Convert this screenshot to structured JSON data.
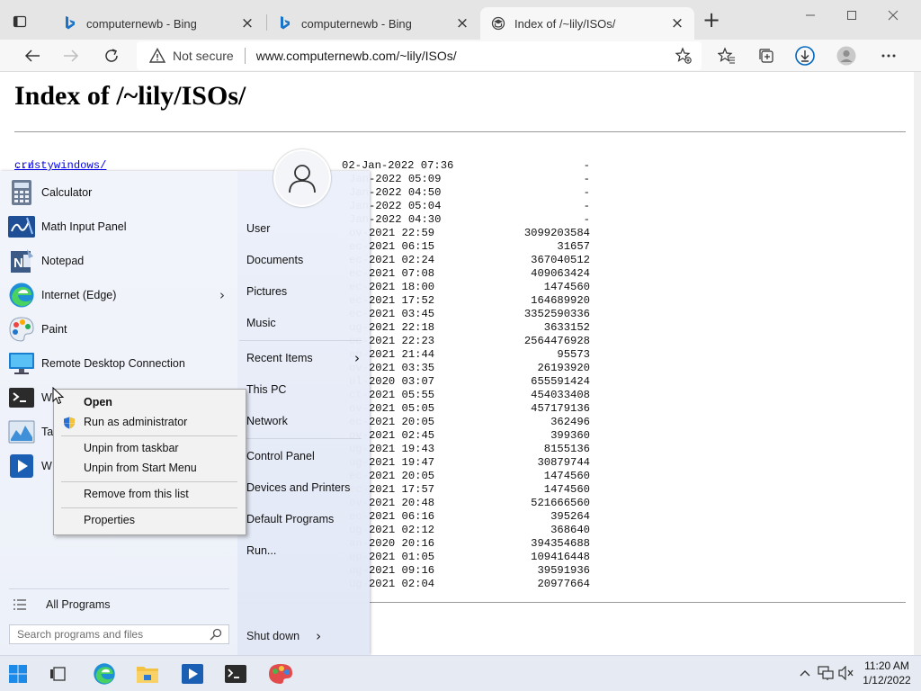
{
  "browser": {
    "tabs": [
      {
        "label": "computernewb - Bing",
        "favicon": "bing-icon",
        "active": false
      },
      {
        "label": "computernewb - Bing",
        "favicon": "bing-icon",
        "active": false
      },
      {
        "label": "Index of /~lily/ISOs/",
        "favicon": "generic-page-icon",
        "active": true
      }
    ],
    "address": {
      "security_label": "Not secure",
      "url": "www.computernewb.com/~lily/ISOs/"
    },
    "accent_color": "#0067c0"
  },
  "page": {
    "title": "Index of /~lily/ISOs/",
    "parent_link": "../",
    "rows": [
      {
        "name": "crustywindows/",
        "link": true,
        "date": "02-Jan-2022 07:36",
        "size": "-"
      },
      {
        "name": "",
        "link": false,
        "date": "Jan-2022 05:09",
        "size": "-"
      },
      {
        "name": "",
        "link": false,
        "date": "Jan-2022 04:50",
        "size": "-"
      },
      {
        "name": "",
        "link": false,
        "date": "Jan-2022 05:04",
        "size": "-"
      },
      {
        "name": "",
        "link": false,
        "date": "Jan-2022 04:30",
        "size": "-"
      },
      {
        "name": "",
        "link": false,
        "date": "ov-2021 22:59",
        "size": "3099203584"
      },
      {
        "name": "",
        "link": false,
        "date": "ec-2021 06:15",
        "size": "31657"
      },
      {
        "name": "",
        "link": false,
        "date": "ec-2021 02:24",
        "size": "367040512"
      },
      {
        "name": "",
        "link": false,
        "date": "ec-2021 07:08",
        "size": "409063424"
      },
      {
        "name": "",
        "link": false,
        "date": "ec-2021 18:00",
        "size": "1474560"
      },
      {
        "name": "",
        "link": false,
        "date": "ec-2021 17:52",
        "size": "164689920"
      },
      {
        "name": "",
        "link": false,
        "date": "ec-2021 03:45",
        "size": "3352590336"
      },
      {
        "name": "",
        "link": false,
        "date": "ug-2021 22:18",
        "size": "3633152"
      },
      {
        "name": "",
        "link": false,
        "date": "ec-2021 22:23",
        "size": "2564476928"
      },
      {
        "name": "",
        "link": false,
        "date": "ep-2021 21:44",
        "size": "95573"
      },
      {
        "name": "",
        "link": false,
        "date": "ov-2021 03:35",
        "size": "26193920"
      },
      {
        "name": "",
        "link": false,
        "date": "ul-2020 03:07",
        "size": "655591424"
      },
      {
        "name": "",
        "link": false,
        "date": "ct-2021 05:55",
        "size": "454033408"
      },
      {
        "name": "",
        "link": false,
        "date": "ov-2021 05:05",
        "size": "457179136"
      },
      {
        "name": "",
        "link": false,
        "date": "ec-2021 20:05",
        "size": "362496"
      },
      {
        "name": "",
        "link": false,
        "date": "ov-2021 02:45",
        "size": "399360"
      },
      {
        "name": "",
        "link": false,
        "date": "ug-2021 19:43",
        "size": "8155136"
      },
      {
        "name": "",
        "link": false,
        "date": "ug-2021 19:47",
        "size": "30879744"
      },
      {
        "name": "",
        "link": false,
        "date": "ec-2021 20:05",
        "size": "1474560"
      },
      {
        "name": "",
        "link": false,
        "date": "ec-2021 17:57",
        "size": "1474560"
      },
      {
        "name": "",
        "link": false,
        "date": "ov-2021 20:48",
        "size": "521666560"
      },
      {
        "name": "",
        "link": false,
        "date": "ec-2021 06:16",
        "size": "395264"
      },
      {
        "name": "",
        "link": false,
        "date": "ug-2021 02:12",
        "size": "368640"
      },
      {
        "name": "",
        "link": false,
        "date": "an-2020 20:16",
        "size": "394354688"
      },
      {
        "name": "",
        "link": false,
        "date": "ep-2021 01:05",
        "size": "109416448"
      },
      {
        "name": "",
        "link": false,
        "date": "ug-2021 09:16",
        "size": "39591936"
      },
      {
        "name": "",
        "link": false,
        "date": "ug-2021 02:04",
        "size": "20977664"
      }
    ]
  },
  "start_menu": {
    "left": {
      "items": [
        {
          "label": "Calculator",
          "icon": "calculator-icon",
          "has_arrow": false
        },
        {
          "label": "Math Input Panel",
          "icon": "math-input-icon",
          "has_arrow": false
        },
        {
          "label": "Notepad",
          "icon": "notepad-icon",
          "has_arrow": false
        },
        {
          "label": "Internet (Edge)",
          "icon": "edge-icon",
          "has_arrow": true
        },
        {
          "label": "Paint",
          "icon": "paint-icon",
          "has_arrow": false
        },
        {
          "label": "Remote Desktop Connection",
          "icon": "remote-desktop-icon",
          "has_arrow": false
        },
        {
          "label": "W",
          "icon": "terminal-icon",
          "has_arrow": false
        },
        {
          "label": "Ta",
          "icon": "task-manager-icon",
          "has_arrow": false
        },
        {
          "label": "W",
          "icon": "media-player-icon",
          "has_arrow": false
        }
      ],
      "all_programs": "All Programs",
      "search_placeholder": "Search programs and files"
    },
    "right": {
      "places": [
        {
          "label": "User",
          "has_arrow": false
        },
        {
          "label": "Documents",
          "has_arrow": false
        },
        {
          "label": "Pictures",
          "has_arrow": false
        },
        {
          "label": "Music",
          "has_arrow": false
        },
        {
          "label": "Recent Items",
          "has_arrow": true
        },
        {
          "label": "This PC",
          "has_arrow": false
        },
        {
          "label": "Network",
          "has_arrow": false
        },
        {
          "label": "Control Panel",
          "has_arrow": false
        },
        {
          "label": "Devices and Printers",
          "has_arrow": false
        },
        {
          "label": "Default Programs",
          "has_arrow": false
        },
        {
          "label": "Run...",
          "has_arrow": false
        }
      ],
      "shutdown": "Shut down"
    }
  },
  "context_menu": {
    "items": [
      {
        "label": "Open",
        "bold": true
      },
      {
        "label": "Run as administrator",
        "bold": false,
        "icon": "uac-shield-icon"
      },
      {
        "label": "Unpin from taskbar",
        "bold": false
      },
      {
        "label": "Unpin from Start Menu",
        "bold": false
      },
      {
        "label": "Remove from this list",
        "bold": false
      },
      {
        "label": "Properties",
        "bold": false
      }
    ]
  },
  "taskbar": {
    "pinned": [
      "start-icon",
      "task-view-icon",
      "edge-icon",
      "file-explorer-icon",
      "media-player-icon",
      "terminal-icon",
      "paint3d-icon"
    ],
    "clock": {
      "time": "11:20 AM",
      "date": "1/12/2022"
    }
  }
}
